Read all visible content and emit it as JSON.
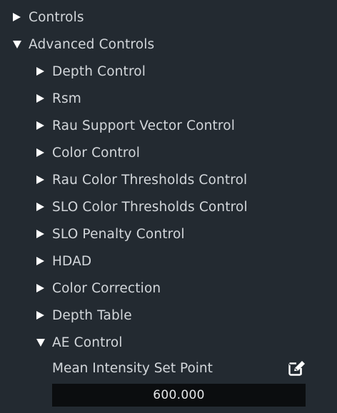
{
  "tree": {
    "controls": {
      "label": "Controls",
      "expanded": false
    },
    "advanced_controls": {
      "label": "Advanced Controls",
      "expanded": true
    },
    "children": [
      {
        "label": "Depth Control",
        "expanded": false
      },
      {
        "label": "Rsm",
        "expanded": false
      },
      {
        "label": "Rau Support Vector Control",
        "expanded": false
      },
      {
        "label": "Color Control",
        "expanded": false
      },
      {
        "label": "Rau Color Thresholds Control",
        "expanded": false
      },
      {
        "label": "SLO Color Thresholds Control",
        "expanded": false
      },
      {
        "label": "SLO Penalty Control",
        "expanded": false
      },
      {
        "label": "HDAD",
        "expanded": false
      },
      {
        "label": "Color Correction",
        "expanded": false
      },
      {
        "label": "Depth Table",
        "expanded": false
      },
      {
        "label": "AE Control",
        "expanded": true
      }
    ]
  },
  "ae_control": {
    "property_label": "Mean Intensity Set Point",
    "value": "600.000",
    "edit_icon": "edit-icon"
  },
  "colors": {
    "background": "#232a31",
    "text": "#d3d7db",
    "arrow": "#ffffff",
    "value_box": "#0b0d0f"
  }
}
